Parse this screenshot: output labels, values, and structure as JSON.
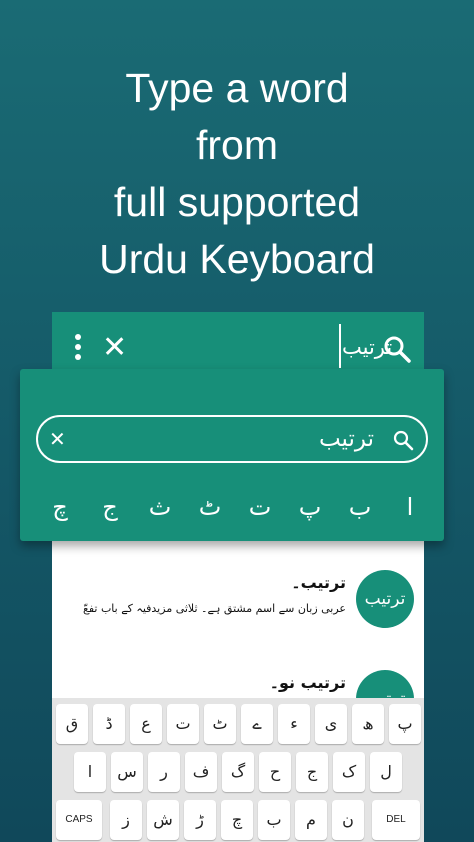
{
  "headline": {
    "line1": "Type a word",
    "line2": "from",
    "line3": "full supported",
    "line4": "Urdu Keyboard"
  },
  "toolbar": {
    "query": "ترتیب",
    "menu_icon": "more-vertical-icon",
    "close_icon": "close-icon",
    "search_icon": "search-icon",
    "close_glyph": "✕"
  },
  "search_card": {
    "input_value": "ترتیب",
    "clear_glyph": "✕",
    "letters": [
      "ا",
      "ب",
      "پ",
      "ت",
      "ٹ",
      "ث",
      "ج",
      "چ"
    ]
  },
  "results": [
    {
      "avatar": "ترتیب",
      "title": "ترتیب۔",
      "description": "عربی زبان سے اسم مشتق ہے۔ ثلاثی مزیدفیہ کے باب تفعّ"
    },
    {
      "avatar": "ترتیب",
      "title": "ترتیب نو۔",
      "description": ""
    }
  ],
  "keyboard": {
    "row1": [
      "پ",
      "ھ",
      "ی",
      "ء",
      "ے",
      "ٹ",
      "ت",
      "ع",
      "ڈ",
      "ق"
    ],
    "row2": [
      "ل",
      "ک",
      "ج",
      "ح",
      "گ",
      "ف",
      "ر",
      "س",
      "ا"
    ],
    "row3": [
      "DEL",
      "ن",
      "م",
      "ب",
      "چ",
      "ڑ",
      "ش",
      "ز",
      "CAPS"
    ]
  },
  "colors": {
    "accent": "#178f79",
    "background_top": "#1a6b74",
    "background_bottom": "#10485a"
  }
}
